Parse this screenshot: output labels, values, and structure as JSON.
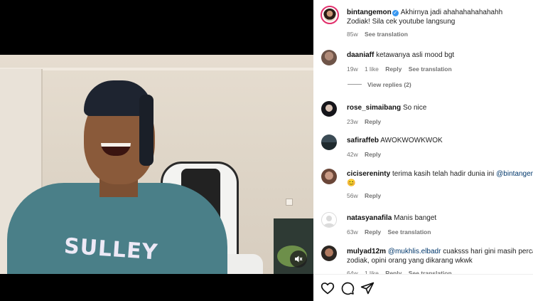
{
  "post": {
    "username": "bintangemon",
    "caption_line1": "Akhirnya jadi ahahahahahahahh",
    "caption_line2": "Zodiak! Sila cek youtube langsung",
    "time": "85w",
    "see_translation": "See translation"
  },
  "video": {
    "shirt_text": "SULLEY",
    "mute_icon": "speaker-muted-icon"
  },
  "comments": [
    {
      "user": "daaniaff",
      "text": "ketawanya asli mood bgt",
      "time": "19w",
      "likes": "1 like",
      "reply": "Reply",
      "translate": "See translation"
    },
    {
      "user": "rose_simaibang",
      "text": "So nice",
      "time": "23w",
      "reply": "Reply"
    },
    {
      "user": "safiraffeb",
      "text": "AWOKWOWKWOK",
      "time": "42w",
      "reply": "Reply"
    },
    {
      "user": "cicisereninty",
      "text": "terima kasih telah hadir dunia ini",
      "mention": "@bintangemon",
      "emoji": "😊",
      "time": "56w",
      "reply": "Reply"
    },
    {
      "user": "natasyanafila",
      "text": "Manis banget",
      "time": "63w",
      "reply": "Reply",
      "translate": "See translation"
    },
    {
      "user": "mulyad12m",
      "mention": "@mukhlis.elbadr",
      "text": "cuaksss hari gini masih percay",
      "text2": "zodiak, opini orang yang dikarang wkwk",
      "time": "64w",
      "likes": "1 like",
      "reply": "Reply",
      "translate": "See translation"
    }
  ],
  "view_replies": "View replies (2)",
  "actions": {
    "like_icon": "heart-icon",
    "comment_icon": "comment-icon",
    "share_icon": "share-icon"
  },
  "colors": {
    "verified": "#3897f0",
    "story_ring": "#e1306c",
    "mention": "#00376b",
    "meta": "#737373"
  }
}
